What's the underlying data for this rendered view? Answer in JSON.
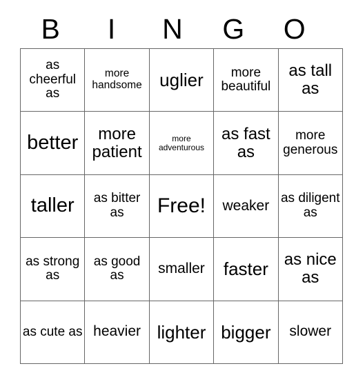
{
  "card": {
    "header_letters": [
      "B",
      "I",
      "N",
      "G",
      "O"
    ],
    "rows": [
      [
        {
          "text": "as cheerful as",
          "size": "fs-m"
        },
        {
          "text": "more handsome",
          "size": "fs-s"
        },
        {
          "text": "uglier",
          "size": "fs-xl"
        },
        {
          "text": "more beautiful",
          "size": "fs-m"
        },
        {
          "text": "as tall as",
          "size": "fs-l"
        }
      ],
      [
        {
          "text": "better",
          "size": "fs-xxl"
        },
        {
          "text": "more patient",
          "size": "fs-l"
        },
        {
          "text": "more adventurous",
          "size": "fs-xs"
        },
        {
          "text": "as fast as",
          "size": "fs-l"
        },
        {
          "text": "more generous",
          "size": "fs-m"
        }
      ],
      [
        {
          "text": "taller",
          "size": "fs-xxl"
        },
        {
          "text": "as bitter as",
          "size": "fs-m"
        },
        {
          "text": "Free!",
          "size": "fs-free"
        },
        {
          "text": "weaker",
          "size": "fs-ml"
        },
        {
          "text": "as diligent as",
          "size": "fs-m"
        }
      ],
      [
        {
          "text": "as strong as",
          "size": "fs-m"
        },
        {
          "text": "as good as",
          "size": "fs-m"
        },
        {
          "text": "smaller",
          "size": "fs-ml"
        },
        {
          "text": "faster",
          "size": "fs-xl"
        },
        {
          "text": "as nice as",
          "size": "fs-l"
        }
      ],
      [
        {
          "text": "as cute as",
          "size": "fs-m"
        },
        {
          "text": "heavier",
          "size": "fs-ml"
        },
        {
          "text": "lighter",
          "size": "fs-xl"
        },
        {
          "text": "bigger",
          "size": "fs-xl"
        },
        {
          "text": "slower",
          "size": "fs-ml"
        }
      ]
    ]
  },
  "colors": {
    "background": "#ffffff",
    "text": "#000000",
    "grid_line": "#666666"
  }
}
